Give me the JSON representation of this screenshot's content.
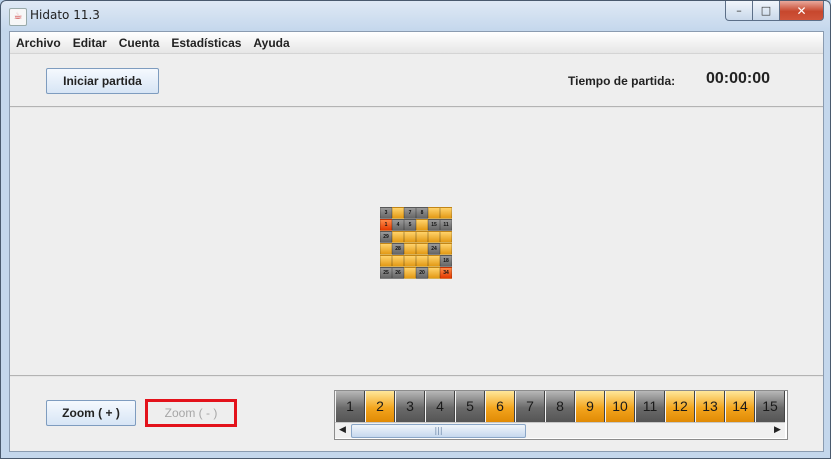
{
  "window": {
    "title": "Hidato 11.3",
    "buttons": {
      "minimize": "–",
      "maximize": "□",
      "close": "✕"
    },
    "icon": "java-cup-icon"
  },
  "menu": [
    "Archivo",
    "Editar",
    "Cuenta",
    "Estadísticas",
    "Ayuda"
  ],
  "toolbar": {
    "start_label": "Iniciar partida",
    "time_label": "Tiempo de partida:",
    "time_value": "00:00:00"
  },
  "board": {
    "cells": [
      [
        "3",
        "",
        "7",
        "8",
        "",
        ""
      ],
      [
        "1",
        "4",
        "5",
        "",
        "15",
        "11"
      ],
      [
        "29",
        "",
        "",
        "",
        "",
        ""
      ],
      [
        "",
        "28",
        "",
        "",
        "24",
        ""
      ],
      [
        "",
        "",
        "",
        "",
        "",
        "18"
      ],
      [
        "25",
        "26",
        "",
        "20",
        "",
        "34"
      ]
    ],
    "types": [
      [
        "g",
        "o",
        "g",
        "g",
        "o",
        "o"
      ],
      [
        "r",
        "g",
        "g",
        "o",
        "g",
        "g"
      ],
      [
        "g",
        "o",
        "o",
        "o",
        "o",
        "o"
      ],
      [
        "o",
        "g",
        "o",
        "o",
        "g",
        "o"
      ],
      [
        "o",
        "o",
        "o",
        "o",
        "o",
        "g"
      ],
      [
        "g",
        "g",
        "o",
        "g",
        "o",
        "r"
      ]
    ]
  },
  "bottom": {
    "zoom_in_label": "Zoom ( + )",
    "zoom_out_label": "Zoom ( - )"
  },
  "palette": {
    "tiles": [
      {
        "label": "1",
        "style": "gray"
      },
      {
        "label": "2",
        "style": "orange"
      },
      {
        "label": "3",
        "style": "gray"
      },
      {
        "label": "4",
        "style": "gray"
      },
      {
        "label": "5",
        "style": "gray"
      },
      {
        "label": "6",
        "style": "orange"
      },
      {
        "label": "7",
        "style": "gray"
      },
      {
        "label": "8",
        "style": "gray"
      },
      {
        "label": "9",
        "style": "orange"
      },
      {
        "label": "10",
        "style": "orange"
      },
      {
        "label": "11",
        "style": "gray"
      },
      {
        "label": "12",
        "style": "orange"
      },
      {
        "label": "13",
        "style": "orange"
      },
      {
        "label": "14",
        "style": "orange"
      },
      {
        "label": "15",
        "style": "gray"
      }
    ],
    "scroll_left": "◀",
    "scroll_right": "▶"
  },
  "colors": {
    "tile_gray": "#6a6a6a",
    "tile_orange": "#f3a51d",
    "highlight": "#e3121b"
  }
}
